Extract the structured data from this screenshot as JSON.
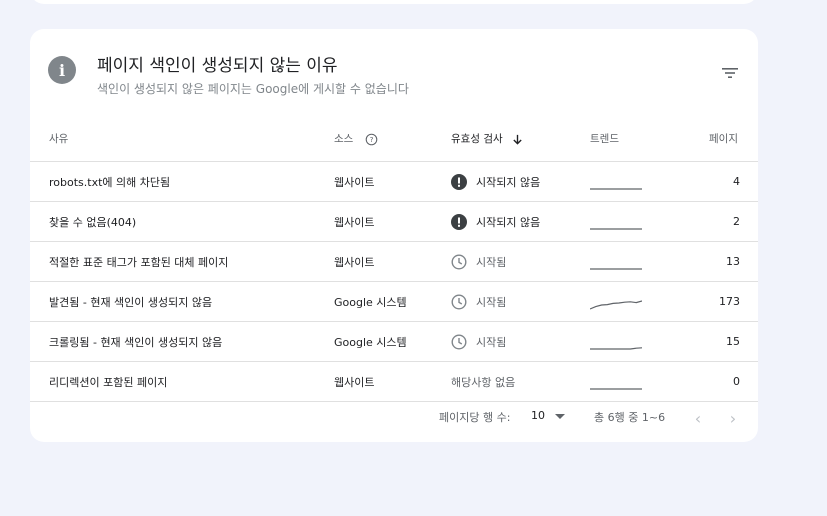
{
  "card": {
    "title": "페이지 색인이 생성되지 않는 이유",
    "subtitle": "색인이 생성되지 않은 페이지는 Google에 게시할 수 없습니다"
  },
  "columns": {
    "reason": "사유",
    "source": "소스",
    "validation": "유효성 검사",
    "trend": "트렌드",
    "pages": "페이지"
  },
  "rows": [
    {
      "reason": "robots.txt에 의해 차단됨",
      "source": "웹사이트",
      "status": "시작되지 않음",
      "status_type": "fail",
      "trend": [
        0,
        0,
        0,
        0,
        0,
        0,
        0,
        0
      ],
      "pages": "4"
    },
    {
      "reason": "찾을 수 없음(404)",
      "source": "웹사이트",
      "status": "시작되지 않음",
      "status_type": "fail",
      "trend": [
        0,
        0,
        0,
        0,
        0,
        0,
        0,
        0
      ],
      "pages": "2"
    },
    {
      "reason": "적절한 표준 태그가 포함된 대체 페이지",
      "source": "웹사이트",
      "status": "시작됨",
      "status_type": "started",
      "trend": [
        0,
        0,
        0,
        0,
        0,
        0,
        0,
        0
      ],
      "pages": "13"
    },
    {
      "reason": "발견됨 - 현재 색인이 생성되지 않음",
      "source": "Google 시스템",
      "status": "시작됨",
      "status_type": "started",
      "trend": [
        0,
        0.3,
        0.5,
        0.55,
        0.7,
        0.75,
        0.85,
        0.9,
        0.8,
        1
      ],
      "pages": "173"
    },
    {
      "reason": "크롤링됨 - 현재 색인이 생성되지 않음",
      "source": "Google 시스템",
      "status": "시작됨",
      "status_type": "started",
      "trend": [
        0,
        0,
        0,
        0,
        0,
        0,
        0,
        0,
        0.1,
        0.15
      ],
      "pages": "15"
    },
    {
      "reason": "리디렉션이 포함된 페이지",
      "source": "웹사이트",
      "status": "해당사항 없음",
      "status_type": "none",
      "trend": [
        0,
        0,
        0,
        0,
        0,
        0,
        0,
        0
      ],
      "pages": "0"
    }
  ],
  "footer": {
    "rows_per_page_label": "페이지당 행 수:",
    "rows_per_page_value": "10",
    "range": "총 6행 중 1~6"
  },
  "colors": {
    "fail_icon": "#3c4043",
    "started_icon": "#80868b",
    "trend_line": "#5f6368"
  },
  "icons": {
    "info": "info-icon",
    "filter": "filter-icon",
    "help": "help-icon",
    "sort": "arrow-down-icon",
    "fail": "exclamation-circle-icon",
    "started": "clock-icon",
    "prev": "chevron-left-icon",
    "next": "chevron-right-icon"
  }
}
